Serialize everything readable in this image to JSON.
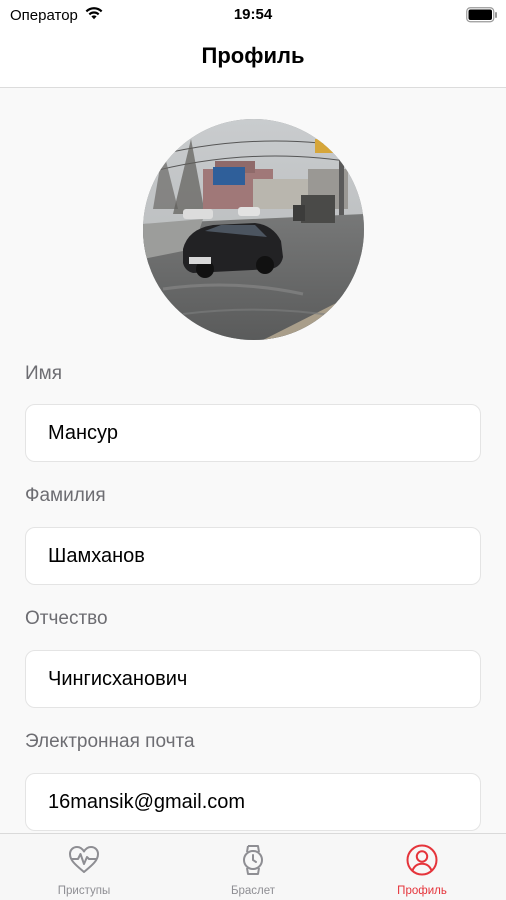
{
  "status_bar": {
    "carrier": "Оператор",
    "time": "19:54"
  },
  "nav": {
    "title": "Профиль"
  },
  "profile": {
    "avatar_icon": "profile-photo",
    "fields": [
      {
        "label": "Имя",
        "value": "Мансур"
      },
      {
        "label": "Фамилия",
        "value": "Шамханов"
      },
      {
        "label": "Отчество",
        "value": "Чингисханович"
      },
      {
        "label": "Электронная почта",
        "value": "16mansik@gmail.com"
      }
    ]
  },
  "tabs": [
    {
      "label": "Приступы",
      "icon": "heartbeat-icon",
      "active": false
    },
    {
      "label": "Браслет",
      "icon": "watch-icon",
      "active": false
    },
    {
      "label": "Профиль",
      "icon": "user-circle-icon",
      "active": true
    }
  ],
  "colors": {
    "accent": "#e5343b",
    "inactive": "#8e8e93",
    "background": "#f9f9f9",
    "field_bg": "#ffffff",
    "label": "#6d6d72"
  }
}
